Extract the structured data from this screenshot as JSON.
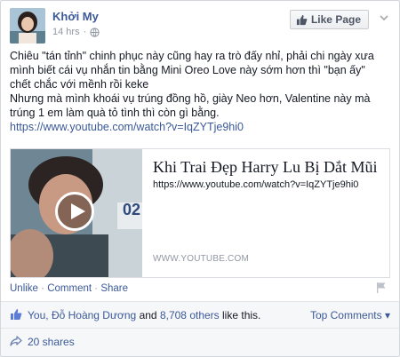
{
  "post": {
    "page_name": "Khởi My",
    "time": "14 hrs",
    "like_page_label": "Like Page",
    "text_lines": [
      "Chiêu \"tán tỉnh\" chinh phục này cũng hay ra trò đấy nhỉ, phải chi ngày xưa",
      "mình biết cái vụ nhắn tin bằng Mini Oreo Love này sớm hơn thì \"bạn ấy\"",
      "chết chắc với mềnh rồi keke",
      "Nhưng mà mình khoái vụ trúng đồng hồ, giày Neo hơn, Valentine này mà",
      "trúng 1 em làm quà tỏ tình thì còn gì bằng."
    ],
    "link_text": "https://www.youtube.com/watch?v=IqZYTje9hi0"
  },
  "video_card": {
    "title": "Khi Trai Đẹp Harry Lu Bị Dắt Mũi",
    "url": "https://www.youtube.com/watch?v=IqZYTje9hi0",
    "source": "WWW.YOUTUBE.COM",
    "thumbnail_text": "02"
  },
  "actions": {
    "unlike": "Unlike",
    "comment": "Comment",
    "share": "Share",
    "separator": "·"
  },
  "likes": {
    "you": "You,",
    "friend": "Đỗ Hoàng Dương",
    "and": "and",
    "others": "8,708 others",
    "suffix": "like this.",
    "top_comments": "Top Comments ▾"
  },
  "shares": {
    "label": "20 shares"
  },
  "colors": {
    "link": "#3b5998",
    "muted": "#9197a3"
  }
}
